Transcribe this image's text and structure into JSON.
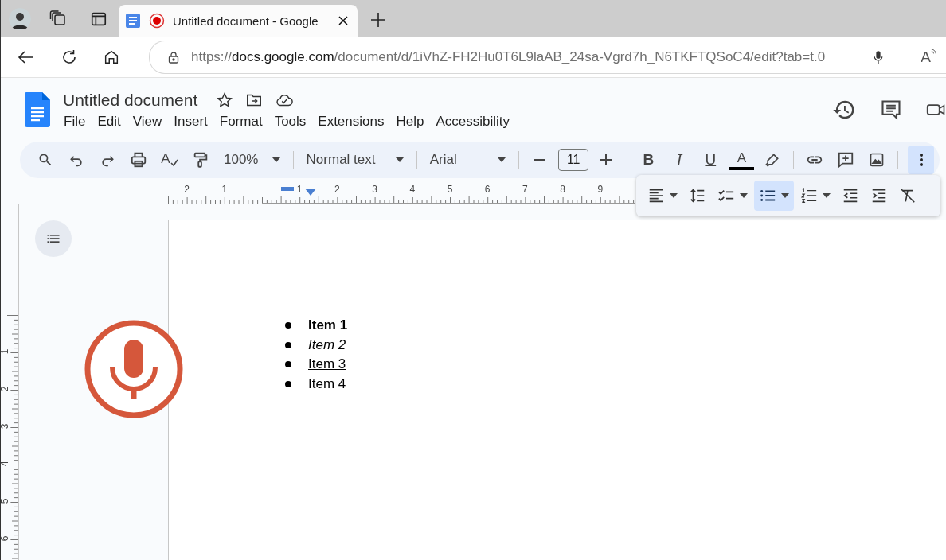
{
  "browser": {
    "tabs": [
      {
        "title": "Untitled document - Google",
        "selected": true,
        "recording": true
      }
    ],
    "address": {
      "scheme": "https://",
      "host": "docs.google.com",
      "path": "/document/d/1iVhZ-FH2Hu0T6L9laAB_24sa-Vgrd7h_N6TKFTQSoC4/edit?tab=t.0",
      "read_aloud_glyph": "A"
    }
  },
  "document": {
    "title": "Untitled document",
    "menu": [
      "File",
      "Edit",
      "View",
      "Insert",
      "Format",
      "Tools",
      "Extensions",
      "Help",
      "Accessibility"
    ]
  },
  "toolbar": {
    "spellcheck_glyph": "A",
    "zoom": "100%",
    "paragraph_style": "Normal text",
    "font": "Arial",
    "font_size": "11",
    "format_buttons": [
      {
        "kind": "bold",
        "label": "B"
      },
      {
        "kind": "italic",
        "label": "I"
      },
      {
        "kind": "underline",
        "label": "U"
      },
      {
        "kind": "text-color",
        "label": "A"
      }
    ],
    "more_selected": true
  },
  "more_tools": [
    {
      "kind": "align",
      "dropdown": true,
      "selected": false
    },
    {
      "kind": "line-spacing",
      "dropdown": false,
      "selected": false
    },
    {
      "kind": "checklist",
      "dropdown": true,
      "selected": false
    },
    {
      "kind": "bulleted-list",
      "dropdown": true,
      "selected": true
    },
    {
      "kind": "numbered-list",
      "dropdown": true,
      "selected": false
    },
    {
      "kind": "decrease-indent",
      "dropdown": false,
      "selected": false
    },
    {
      "kind": "increase-indent",
      "dropdown": false,
      "selected": false
    },
    {
      "kind": "clear-formatting",
      "dropdown": false,
      "selected": false
    }
  ],
  "ruler": {
    "horizontal": [
      "2",
      "1",
      "1",
      "2",
      "3",
      "4",
      "5",
      "6",
      "7",
      "8",
      "9"
    ],
    "vertical": [
      "1",
      "2",
      "3",
      "4",
      "5",
      "6"
    ]
  },
  "voice_typing": {
    "on": true
  },
  "list_items": [
    {
      "text": "Item 1",
      "kind": "bold"
    },
    {
      "text": "Item 2",
      "kind": "italic"
    },
    {
      "text": "Item 3",
      "kind": "underline"
    },
    {
      "text": "Item 4",
      "kind": "plain"
    }
  ]
}
